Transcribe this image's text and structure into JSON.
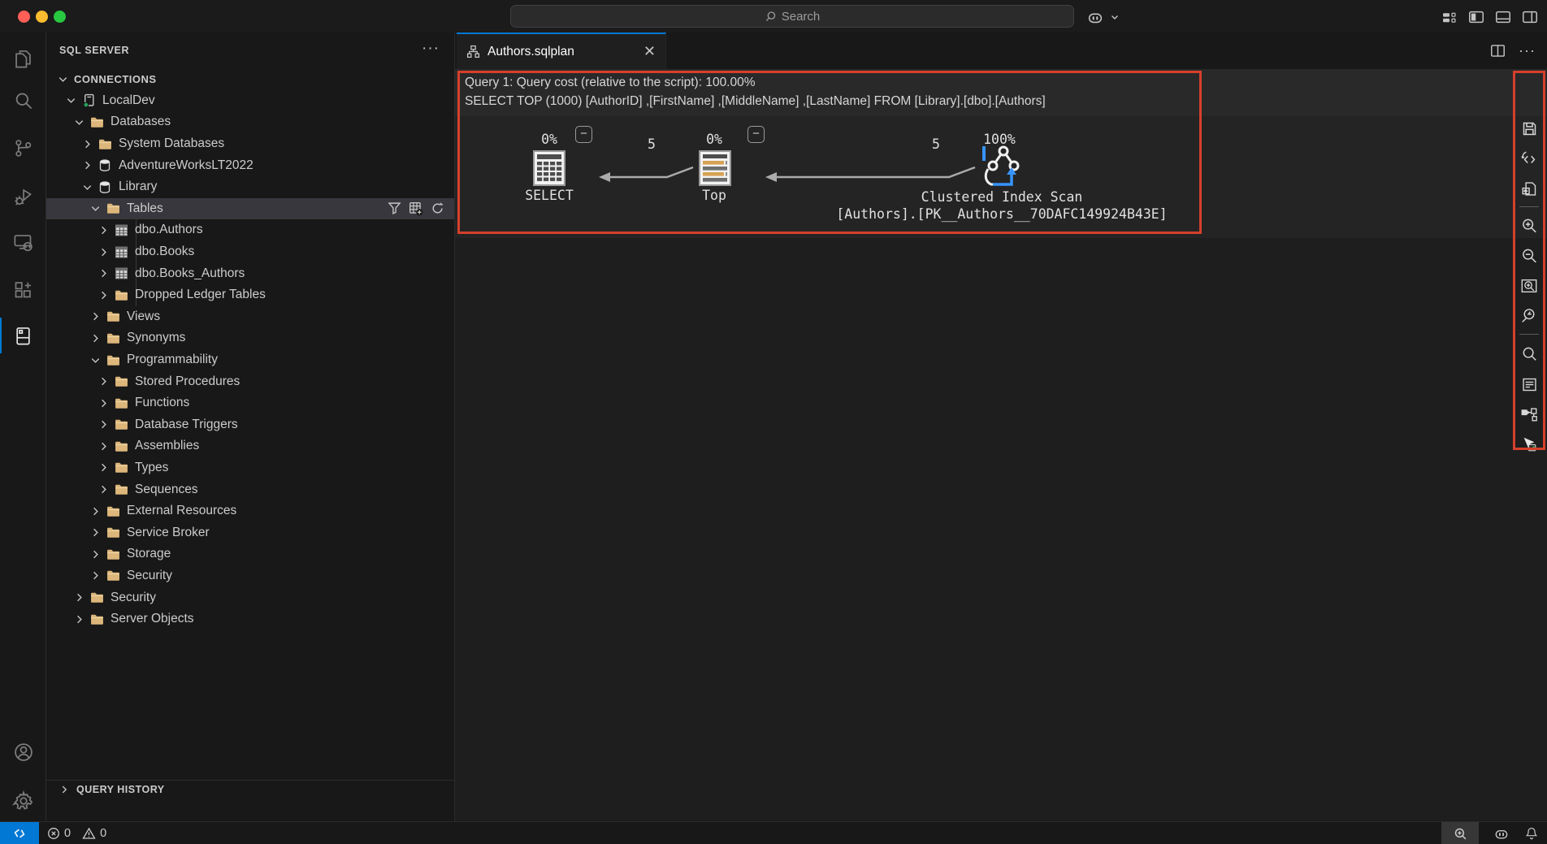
{
  "window": {
    "search_label": "Search",
    "traffic_lights": [
      "close",
      "minimize",
      "zoom"
    ],
    "nav_icons": [
      "arrow-left-icon",
      "arrow-right-icon"
    ],
    "right_icons": [
      "copilot-icon",
      "chevron-down-icon",
      "layout-icon",
      "panel-left-icon",
      "panel-bottom-icon",
      "panel-right-icon"
    ]
  },
  "activity_bar": {
    "items": [
      "explorer-icon",
      "search-icon",
      "source-control-icon",
      "run-debug-icon",
      "remote-explorer-icon",
      "extensions-icon",
      "sql-server-icon"
    ],
    "active_item": "sql-server-icon",
    "bottom_items": [
      "accounts-icon",
      "settings-gear-icon"
    ]
  },
  "sidebar": {
    "title": "SQL SERVER",
    "more_label": "···",
    "tree": [
      {
        "label": "CONNECTIONS",
        "level": 0,
        "state": "expanded",
        "icon": "none"
      },
      {
        "label": "LocalDev",
        "level": 1,
        "state": "expanded",
        "icon": "server-icon"
      },
      {
        "label": "Databases",
        "level": 2,
        "state": "expanded",
        "icon": "folder-icon"
      },
      {
        "label": "System Databases",
        "level": 3,
        "state": "collapsed",
        "icon": "folder-icon"
      },
      {
        "label": "AdventureWorksLT2022",
        "level": 3,
        "state": "collapsed",
        "icon": "database-icon"
      },
      {
        "label": "Library",
        "level": 3,
        "state": "expanded",
        "icon": "database-icon"
      },
      {
        "label": "Tables",
        "level": 4,
        "state": "expanded",
        "icon": "folder-icon",
        "selected": true,
        "actions": [
          "filter-icon",
          "new-table-icon",
          "refresh-icon"
        ]
      },
      {
        "label": "dbo.Authors",
        "level": 5,
        "state": "collapsed",
        "icon": "table-icon"
      },
      {
        "label": "dbo.Books",
        "level": 5,
        "state": "collapsed",
        "icon": "table-icon"
      },
      {
        "label": "dbo.Books_Authors",
        "level": 5,
        "state": "collapsed",
        "icon": "table-icon"
      },
      {
        "label": "Dropped Ledger Tables",
        "level": 5,
        "state": "collapsed",
        "icon": "folder-icon"
      },
      {
        "label": "Views",
        "level": 4,
        "state": "collapsed",
        "icon": "folder-icon"
      },
      {
        "label": "Synonyms",
        "level": 4,
        "state": "collapsed",
        "icon": "folder-icon"
      },
      {
        "label": "Programmability",
        "level": 4,
        "state": "expanded",
        "icon": "folder-icon"
      },
      {
        "label": "Stored Procedures",
        "level": 5,
        "state": "collapsed",
        "icon": "folder-icon"
      },
      {
        "label": "Functions",
        "level": 5,
        "state": "collapsed",
        "icon": "folder-icon"
      },
      {
        "label": "Database Triggers",
        "level": 5,
        "state": "collapsed",
        "icon": "folder-icon"
      },
      {
        "label": "Assemblies",
        "level": 5,
        "state": "collapsed",
        "icon": "folder-icon"
      },
      {
        "label": "Types",
        "level": 5,
        "state": "collapsed",
        "icon": "folder-icon"
      },
      {
        "label": "Sequences",
        "level": 5,
        "state": "collapsed",
        "icon": "folder-icon"
      },
      {
        "label": "External Resources",
        "level": 4,
        "state": "collapsed",
        "icon": "folder-icon"
      },
      {
        "label": "Service Broker",
        "level": 4,
        "state": "collapsed",
        "icon": "folder-icon"
      },
      {
        "label": "Storage",
        "level": 4,
        "state": "collapsed",
        "icon": "folder-icon"
      },
      {
        "label": "Security",
        "level": 4,
        "state": "collapsed",
        "icon": "folder-icon"
      },
      {
        "label": "Security",
        "level": 2,
        "state": "collapsed",
        "icon": "folder-icon"
      },
      {
        "label": "Server Objects",
        "level": 2,
        "state": "collapsed",
        "icon": "folder-icon"
      }
    ],
    "query_history": {
      "label": "QUERY HISTORY"
    }
  },
  "editor": {
    "tab": {
      "label": "Authors.sqlplan",
      "icon": "sqlplan-icon",
      "close": "✕"
    },
    "tabbar_actions": [
      "split-editor-icon",
      "more-actions-icon"
    ],
    "plan": {
      "title_line": "Query 1: Query cost (relative to the script): 100.00%",
      "query_line": "SELECT TOP (1000) [AuthorID] ,[FirstName] ,[MiddleName] ,[LastName] FROM [Library].[dbo].[Authors]",
      "nodes": [
        {
          "cost": "0%",
          "label": "SELECT",
          "icon": "result-operator-icon",
          "collapse_label": "−"
        },
        {
          "cost": "0%",
          "label": "Top",
          "icon": "top-operator-icon",
          "collapse_label": "−"
        },
        {
          "cost": "100%",
          "label": "Clustered Index Scan",
          "sublabel": "[Authors].[PK__Authors__70DAFC149924B43E]",
          "icon": "clustered-index-scan-operator-icon"
        }
      ],
      "edges": [
        {
          "rows": "5"
        },
        {
          "rows": "5"
        }
      ]
    },
    "toolbar": {
      "icons": [
        "save-plan-icon",
        "show-query-xml-icon",
        "open-query-icon",
        "zoom-in-icon",
        "zoom-out-icon",
        "zoom-to-fit-icon",
        "custom-zoom-icon",
        "find-node-icon",
        "properties-icon",
        "highlight-expensive-operation-icon",
        "toggle-tooltip-icon"
      ]
    },
    "highlight_color": "#d5402b"
  },
  "status_bar": {
    "remote_icon": "remote-indicator-icon",
    "errors": "0",
    "warnings": "0",
    "right_icons": [
      "zoom-status-icon",
      "copilot-status-icon",
      "bell-icon"
    ]
  },
  "colors": {
    "accent": "#0078d4",
    "highlight": "#d5402b",
    "folder": "#dcb67a",
    "selection": "#37373d"
  }
}
